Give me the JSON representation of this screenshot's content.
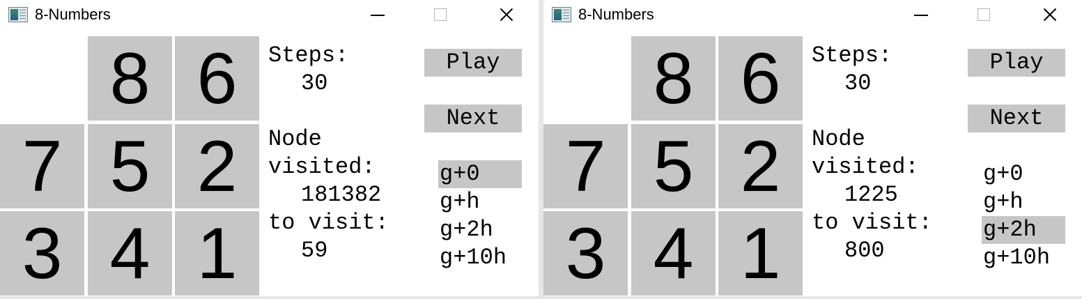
{
  "windows": [
    {
      "title": "8-Numbers",
      "tiles": [
        "",
        "8",
        "6",
        "7",
        "5",
        "2",
        "3",
        "4",
        "1"
      ],
      "steps_label": "Steps:",
      "steps_value": "30",
      "node_label": "Node",
      "visited_label": "visited:",
      "visited_value": "181382",
      "to_visit_label": "to visit:",
      "to_visit_value": "59",
      "buttons": {
        "play": "Play",
        "next": "Next"
      },
      "heuristics": [
        "g+0",
        "g+h",
        "g+2h",
        "g+10h"
      ],
      "selected_heuristic": "g+0",
      "icon": "window-icon"
    },
    {
      "title": "8-Numbers",
      "tiles": [
        "",
        "8",
        "6",
        "7",
        "5",
        "2",
        "3",
        "4",
        "1"
      ],
      "steps_label": "Steps:",
      "steps_value": "30",
      "node_label": "Node",
      "visited_label": "visited:",
      "visited_value": "1225",
      "to_visit_label": "to visit:",
      "to_visit_value": "800",
      "buttons": {
        "play": "Play",
        "next": "Next"
      },
      "heuristics": [
        "g+0",
        "g+h",
        "g+2h",
        "g+10h"
      ],
      "selected_heuristic": "g+2h",
      "icon": "window-icon"
    }
  ],
  "colors": {
    "tile": "#c6c6c6",
    "selected": "#c6c6c6",
    "background": "#ffffff"
  }
}
